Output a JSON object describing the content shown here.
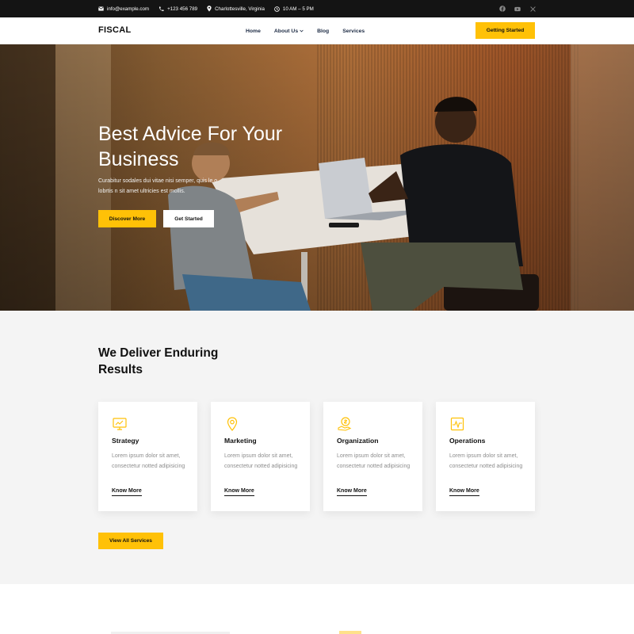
{
  "topbar": {
    "email": "info@example.com",
    "phone": "+123 456 789",
    "location": "Charlottesville, Virginia",
    "hours": "10 AM – 5 PM",
    "social": [
      "facebook-icon",
      "youtube-icon",
      "x-icon"
    ]
  },
  "nav": {
    "logo": "FISCAL",
    "items": [
      {
        "label": "Home"
      },
      {
        "label": "About Us",
        "has_dropdown": true
      },
      {
        "label": "Blog"
      },
      {
        "label": "Services"
      }
    ],
    "cta": "Getting Started"
  },
  "hero": {
    "title": "Best Advice For Your Business",
    "subtitle": "Curabitur sodales dui vitae nisi semper, quis le o lobrtis n sit amet ultricies est mollis.",
    "primary_button": "Discover More",
    "secondary_button": "Get Started"
  },
  "services": {
    "title": "We Deliver Enduring Results",
    "cards": [
      {
        "icon": "monitor-chart-icon",
        "title": "Strategy",
        "text": "Lorem ipsum dolor sit amet, consectetur notted adipisicing",
        "link": "Know More"
      },
      {
        "icon": "location-pin-icon",
        "title": "Marketing",
        "text": "Lorem ipsum dolor sit amet, consectetur notted adipisicing",
        "link": "Know More"
      },
      {
        "icon": "coin-hand-icon",
        "title": "Organization",
        "text": "Lorem ipsum dolor sit amet, consectetur notted adipisicing",
        "link": "Know More"
      },
      {
        "icon": "pulse-board-icon",
        "title": "Operations",
        "text": "Lorem ipsum dolor sit amet, consectetur notted adipisicing",
        "link": "Know More"
      }
    ],
    "button": "View All Services"
  },
  "colors": {
    "accent": "#ffc107",
    "dark": "#141414",
    "nav_text": "#1d2b44",
    "section_bg": "#f4f4f4"
  }
}
